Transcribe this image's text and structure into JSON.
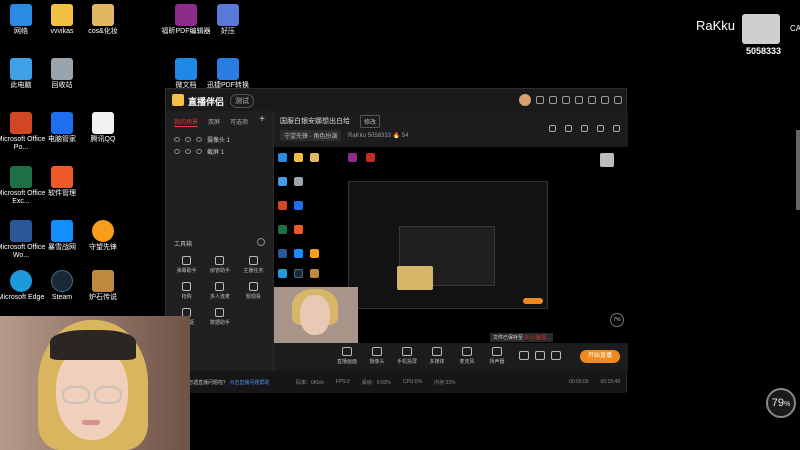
{
  "desktop": {
    "icons": [
      {
        "label": "网络",
        "color": "#2b8ae2"
      },
      {
        "label": "vvvikas",
        "color": "#f0c040"
      },
      {
        "label": "cos&化妆",
        "color": "#e0b860"
      },
      {
        "label": "福昕PDF编辑器",
        "color": "#8e2c8c"
      },
      {
        "label": "好压",
        "color": "#5b79d8"
      },
      {
        "label": "此电脑",
        "color": "#3fa0e8"
      },
      {
        "label": "回收站",
        "color": "#9aa4ad"
      },
      {
        "label": "微文档",
        "color": "#1e88e5"
      },
      {
        "label": "迅捷PDF转换",
        "color": "#2a7de1"
      },
      {
        "label": "Microsoft Office Po...",
        "color": "#d24726"
      },
      {
        "label": "电脑管家",
        "color": "#1e6ff0"
      },
      {
        "label": "腾讯QQ",
        "color": "#f2f2f2"
      },
      {
        "label": "Microsoft Office Exc...",
        "color": "#1d7044"
      },
      {
        "label": "软件管理",
        "color": "#f05a28"
      },
      {
        "label": "Microsoft Office Wo...",
        "color": "#2b5797"
      },
      {
        "label": "暴雪战网",
        "color": "#148eff"
      },
      {
        "label": "守望先锋",
        "color": "#f99e1a"
      },
      {
        "label": "Microsoft Edge",
        "color": "#1c9bd8"
      },
      {
        "label": "Steam",
        "color": "#1b2838"
      },
      {
        "label": "炉石传说",
        "color": "#c08a3e"
      }
    ]
  },
  "overlay": {
    "streamer_name": "RaKku",
    "room_id": "5058333",
    "cut_text": "CA"
  },
  "app": {
    "name": "直播伴侣",
    "version_badge": "测试",
    "sidebar": {
      "tabs": [
        "我的场景",
        "双屏",
        "可选项"
      ],
      "add_label": "+",
      "scenes": [
        "摄像头 1",
        "截屏 1"
      ],
      "toolbox_title": "工具箱",
      "tools": [
        "弹幕助手",
        "房管助手",
        "主播任务",
        "抢购",
        "多人连麦",
        "题观看",
        "弹幕姬",
        "数据助手",
        ""
      ]
    },
    "room": {
      "title": "国服白银安娜想出白给",
      "edit_label": "修改",
      "category": "守望先锋 · 角色扮演",
      "anchor": "RaKku",
      "room_id": "5058333",
      "popularity": "54"
    },
    "preview": {
      "zoom_badge": "7%"
    },
    "controls": {
      "items": [
        "直播画面",
        "摄像头",
        "手机投屏",
        "多媒体",
        "麦克风",
        "扬声器"
      ],
      "save_tip_prefix": "文件已保存至",
      "save_tip_path": "D:\\斗鱼视...",
      "start_label": "开始直播"
    },
    "status": {
      "left_text": "您遇直播问题啦？",
      "left_link": "点击直播问题帮助",
      "stats": [
        "码率：0Kb/s",
        "FPS:0",
        "丢帧：0.00%",
        "CPU:0%",
        "内存:33%"
      ],
      "times": [
        "00:00:00",
        "00:16:48"
      ]
    }
  },
  "badge_percent": "79"
}
